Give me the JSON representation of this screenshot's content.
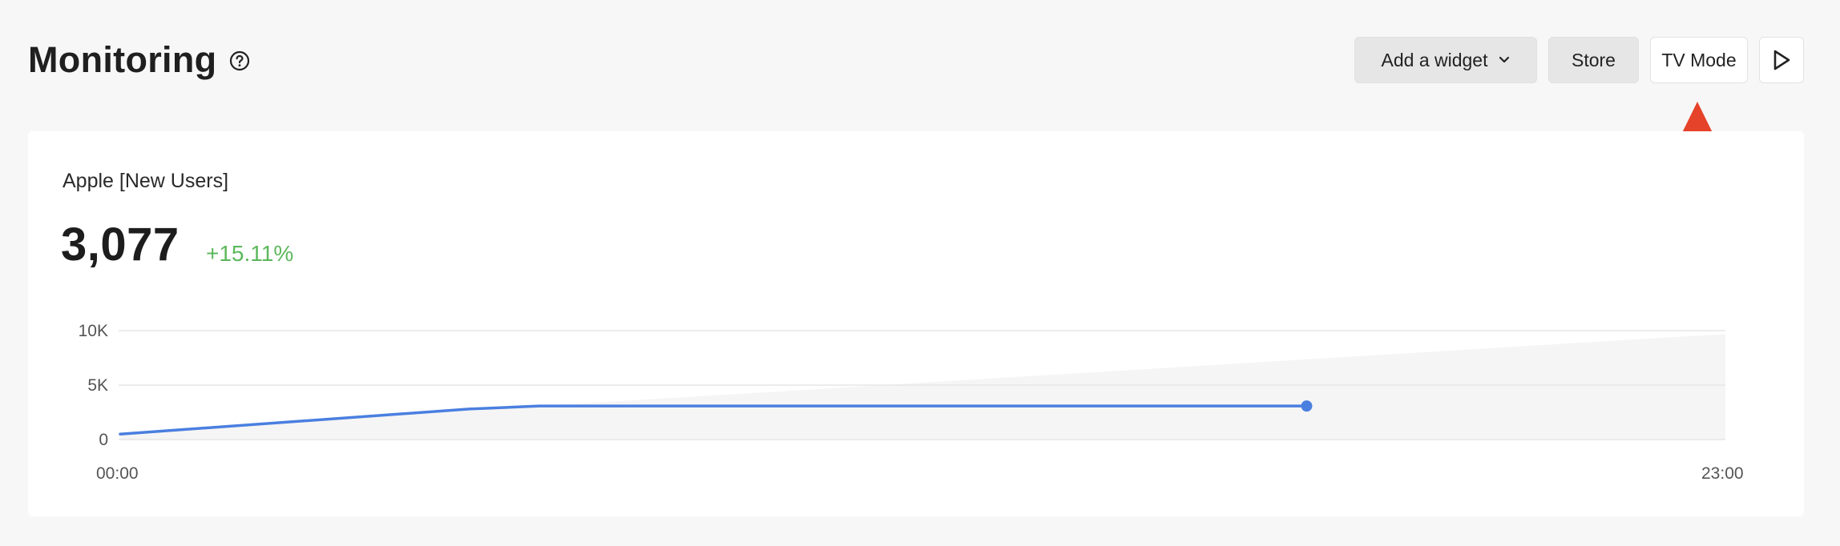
{
  "header": {
    "title": "Monitoring",
    "help_icon": "question-circle-icon",
    "add_widget_label": "Add a widget",
    "store_label": "Store",
    "tv_mode_label": "TV Mode",
    "play_icon": "play-icon"
  },
  "widget": {
    "title": "Apple [New Users]",
    "value": "3,077",
    "delta": "+15.11%",
    "delta_color": "#5cb85c"
  },
  "chart_data": {
    "type": "line",
    "title": "",
    "y_ticks": [
      "10K",
      "5K",
      "0"
    ],
    "y_tick_values": [
      10000,
      5000,
      0
    ],
    "x_ticks": [
      "00:00",
      "23:00"
    ],
    "ylim": [
      0,
      10000
    ],
    "x_range_hours": [
      0,
      23
    ],
    "grid": true,
    "series": [
      {
        "color": "#4a7fe0",
        "points": [
          {
            "x": 0,
            "y": 500
          },
          {
            "x": 5,
            "y": 2800
          },
          {
            "x": 6,
            "y": 3077
          },
          {
            "x": 17,
            "y": 3077
          }
        ]
      }
    ],
    "projection_area": {
      "color": "#f5f5f5",
      "points": [
        {
          "x": 6,
          "y": 3077
        },
        {
          "x": 23,
          "y": 9700
        }
      ]
    }
  },
  "annotation": {
    "arrow_color": "#e5432a"
  }
}
